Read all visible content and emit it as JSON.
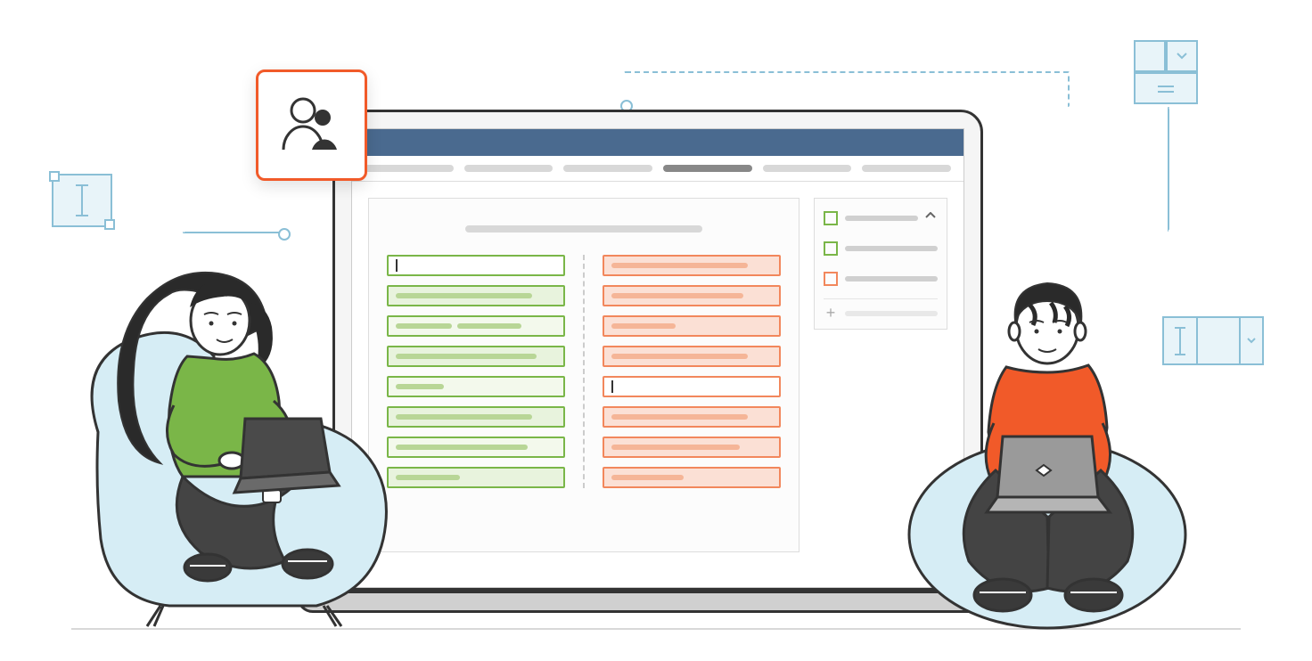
{
  "illustration": {
    "type": "collaboration-editor",
    "people_card": {
      "icon": "people-icon",
      "border_color": "#f15a29"
    },
    "laptop": {
      "header_color": "#4a6a8f",
      "tabs": [
        {
          "active": false
        },
        {
          "active": false
        },
        {
          "active": false
        },
        {
          "active": true
        },
        {
          "active": false
        },
        {
          "active": false
        }
      ],
      "columns": {
        "left": {
          "color": "green",
          "color_hex": "#7ab648",
          "rows": [
            {
              "state": "active-cursor"
            },
            {
              "state": "filled"
            },
            {
              "state": "filled-split"
            },
            {
              "state": "filled"
            },
            {
              "state": "filled-short"
            },
            {
              "state": "filled"
            },
            {
              "state": "filled"
            },
            {
              "state": "filled-short"
            }
          ]
        },
        "right": {
          "color": "orange",
          "color_hex": "#f2875c",
          "rows": [
            {
              "state": "filled"
            },
            {
              "state": "filled"
            },
            {
              "state": "filled-short"
            },
            {
              "state": "filled"
            },
            {
              "state": "active-cursor"
            },
            {
              "state": "filled"
            },
            {
              "state": "filled"
            },
            {
              "state": "filled-short"
            }
          ]
        }
      },
      "side_panel": {
        "items": [
          {
            "color": "green",
            "expand": "collapse"
          },
          {
            "color": "green"
          },
          {
            "color": "orange"
          },
          {
            "add": true
          }
        ]
      }
    },
    "widgets": [
      {
        "type": "text-cursor-selection",
        "position": "top-left"
      },
      {
        "type": "layout-grid-dropdown",
        "position": "top-right"
      },
      {
        "type": "combo-input",
        "position": "right"
      }
    ],
    "people": [
      {
        "position": "left",
        "shirt_color": "#7ab648",
        "hair": "long-black",
        "seat": "armchair"
      },
      {
        "position": "right",
        "shirt_color": "#f15a29",
        "hair": "short-black",
        "seat": "beanbag"
      }
    ]
  }
}
